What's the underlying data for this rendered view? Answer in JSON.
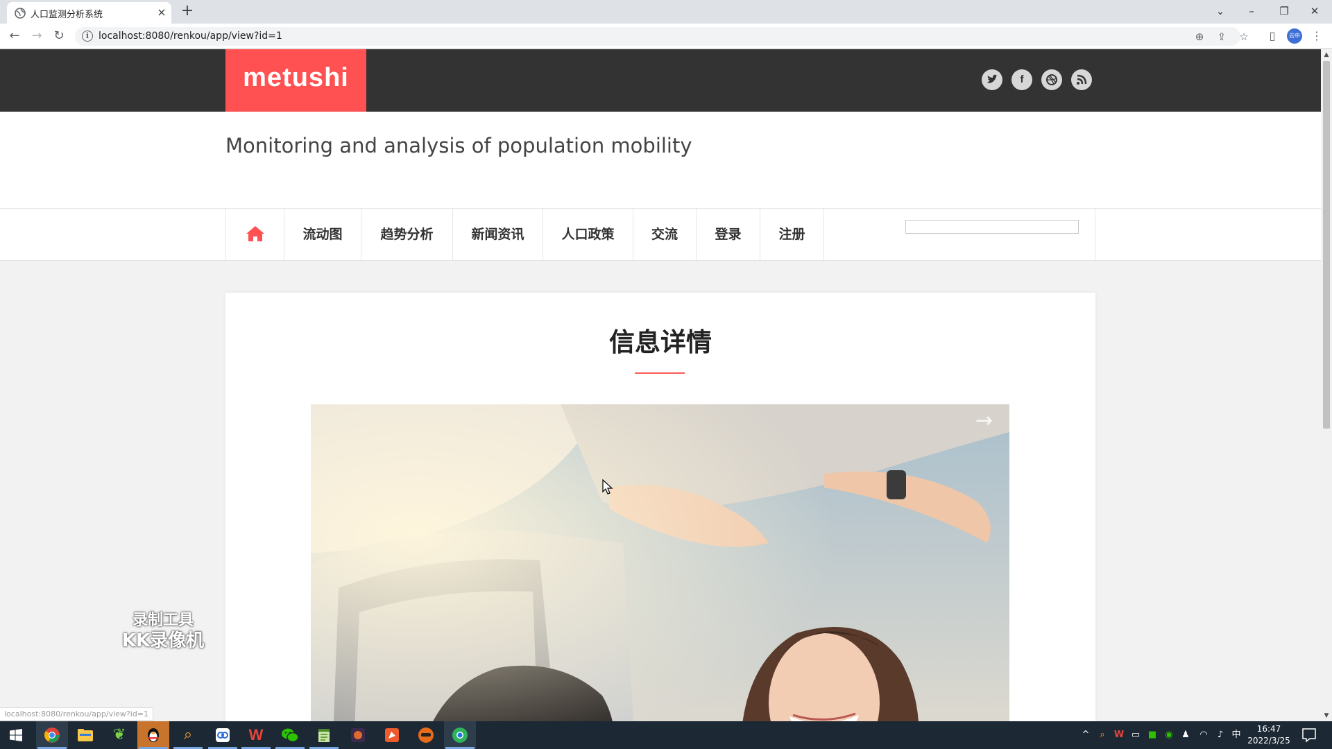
{
  "browser": {
    "tab_title": "人口监测分析系统",
    "tab_close": "×",
    "new_tab": "+",
    "url": "localhost:8080/renkou/app/view?id=1",
    "status_url": "localhost:8080/renkou/app/view?id=1",
    "profile_label": "云中"
  },
  "site": {
    "logo": "metushi",
    "subtitle": "Monitoring and analysis of population mobility",
    "social_icons": [
      "twitter-icon",
      "facebook-icon",
      "dribbble-icon",
      "rss-icon"
    ],
    "accent_color": "#ff5151",
    "header_color": "#333333"
  },
  "nav": {
    "items": [
      "流动图",
      "趋势分析",
      "新闻资讯",
      "人口政策",
      "交流",
      "登录",
      "注册"
    ]
  },
  "content": {
    "heading": "信息详情"
  },
  "watermark": {
    "line1": "录制工具",
    "line2": "KK录像机"
  },
  "taskbar": {
    "time": "16:47",
    "date": "2022/3/25",
    "ime": "中"
  }
}
